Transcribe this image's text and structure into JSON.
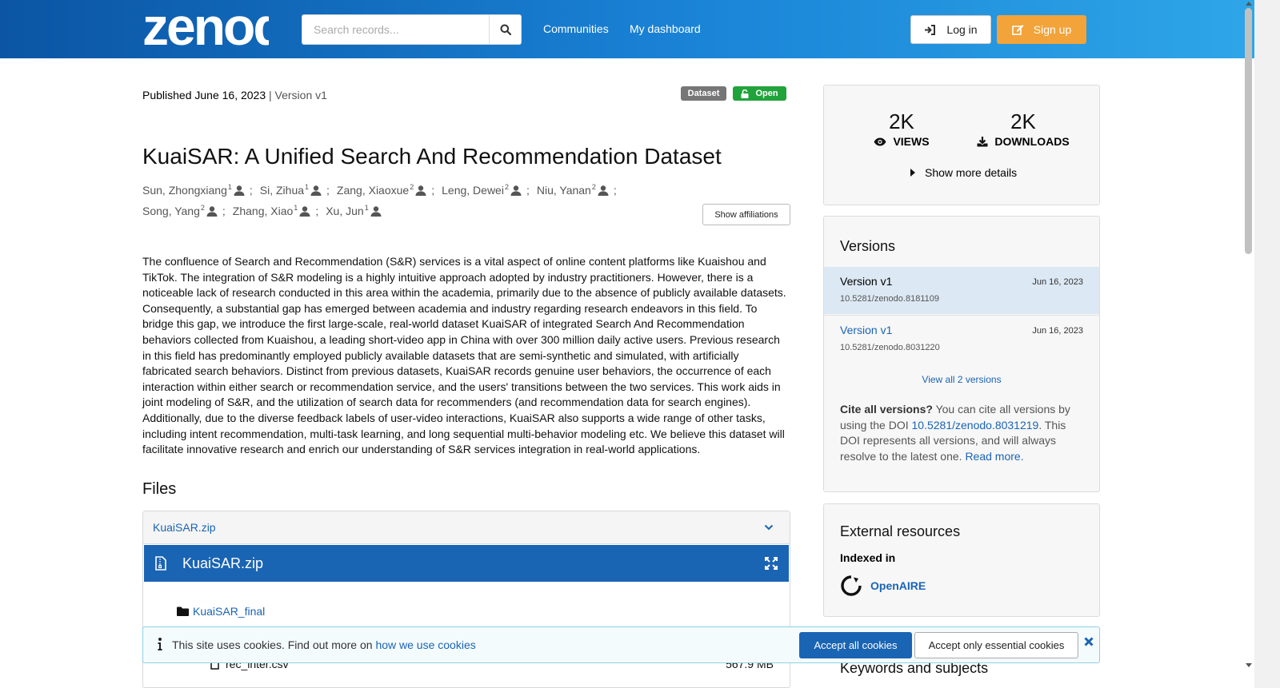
{
  "header": {
    "logo_text": "zenodo",
    "search_placeholder": "Search records...",
    "nav": [
      "Communities",
      "My dashboard"
    ],
    "login_label": "Log in",
    "signup_label": "Sign up"
  },
  "record": {
    "published": "Published June 16, 2023",
    "version": "| Version v1",
    "badge_type": "Dataset",
    "badge_access": "Open",
    "title": "KuaiSAR: A Unified Search And Recommendation Dataset",
    "authors_row1": [
      {
        "name": "Sun, Zhongxiang",
        "aff": "1"
      },
      {
        "name": "Si, Zihua",
        "aff": "1"
      },
      {
        "name": "Zang, Xiaoxue",
        "aff": "2"
      },
      {
        "name": "Leng, Dewei",
        "aff": "2"
      },
      {
        "name": "Niu, Yanan",
        "aff": "2"
      }
    ],
    "authors_row2": [
      {
        "name": "Song, Yang",
        "aff": "2"
      },
      {
        "name": "Zhang, Xiao",
        "aff": "1"
      },
      {
        "name": "Xu, Jun",
        "aff": "1"
      }
    ],
    "show_affiliations": "Show affiliations",
    "abstract": "The confluence of Search and Recommendation (S&R) services is a vital aspect of online content platforms like Kuaishou and TikTok. The integration of S&R modeling is a highly intuitive approach adopted by industry practitioners. However, there is a noticeable lack of research conducted in this area within the academia, primarily due to the absence of publicly available datasets. Consequently, a substantial gap has emerged between academia and industry regarding research endeavors in this field. To bridge this gap, we introduce the first large-scale, real-world dataset KuaiSAR of integrated Search And Recommendation behaviors collected from Kuaishou, a leading short-video app in China with over 300 million daily active users. Previous research in this field has predominantly employed publicly available datasets that are semi-synthetic and simulated, with artificially fabricated search behaviors. Distinct from previous datasets, KuaiSAR records genuine user behaviors, the occurrence of each interaction within either search or recommendation service, and the users' transitions between the two services. This work aids in joint modeling of S&R, and the utilization of search data for recommenders (and recommendation data for search engines). Additionally, due to the diverse feedback labels of user-video interactions, KuaiSAR also supports a wide range of other tasks, including intent recommendation, multi-task learning, and long sequential multi-behavior modeling etc. We believe this dataset will facilitate innovative research and enrich our understanding of S&R services integration in real-world applications."
  },
  "files": {
    "heading": "Files",
    "archive_name": "KuaiSAR.zip",
    "preview_title": "KuaiSAR.zip",
    "folder": "KuaiSAR_final",
    "file_name": "rec_inter.csv",
    "file_size": "567.9 MB"
  },
  "stats": {
    "views_value": "2K",
    "views_label": "VIEWS",
    "downloads_value": "2K",
    "downloads_label": "DOWNLOADS",
    "show_more": "Show more details"
  },
  "versions": {
    "heading": "Versions",
    "items": [
      {
        "name": "Version v1",
        "date": "Jun 16, 2023",
        "doi": "10.5281/zenodo.8181109"
      },
      {
        "name": "Version v1",
        "date": "Jun 16, 2023",
        "doi": "10.5281/zenodo.8031220"
      }
    ],
    "view_all": "View all 2 versions",
    "cite_bold": "Cite all versions?",
    "cite_text1": " You can cite all versions by using the DOI ",
    "cite_doi": "10.5281/zenodo.8031219",
    "cite_text2": ". This DOI represents all versions, and will always resolve to the latest one. ",
    "cite_read_more": "Read more",
    "cite_end": "."
  },
  "external": {
    "heading": "External resources",
    "indexed_in": "Indexed in",
    "openaire": "OpenAIRE"
  },
  "keywords_heading": "Keywords and subjects",
  "cookie": {
    "message": "This site uses cookies. Find out more on ",
    "link": "how we use cookies",
    "accept_all": "Accept all cookies",
    "accept_essential": "Accept only essential cookies"
  },
  "colors": {
    "brand_blue": "#1a64b4",
    "signup_orange": "#f2a33a",
    "open_green": "#21a33b"
  }
}
